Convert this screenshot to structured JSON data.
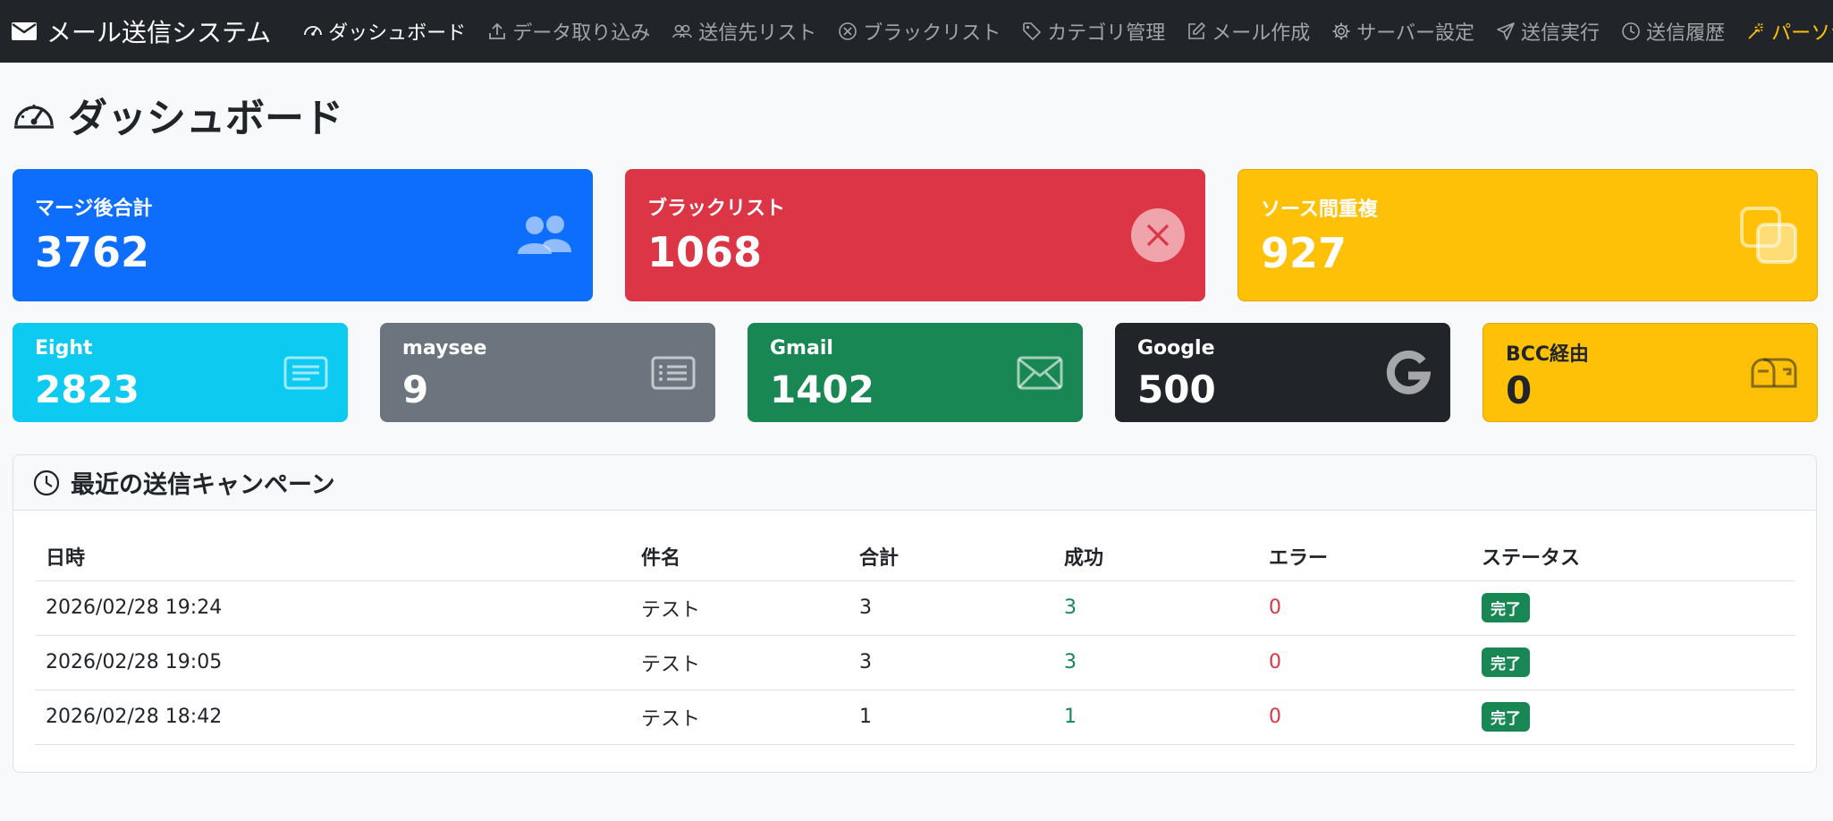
{
  "brand": {
    "title": "メール送信システム",
    "icon": "envelope-icon"
  },
  "nav": [
    {
      "label": "ダッシュボード",
      "icon": "speedometer-icon",
      "state": "active"
    },
    {
      "label": "データ取り込み",
      "icon": "upload-icon",
      "state": "normal"
    },
    {
      "label": "送信先リスト",
      "icon": "people-icon",
      "state": "normal"
    },
    {
      "label": "ブラックリスト",
      "icon": "x-circle-icon",
      "state": "normal"
    },
    {
      "label": "カテゴリ管理",
      "icon": "tag-icon",
      "state": "normal"
    },
    {
      "label": "メール作成",
      "icon": "pencil-square-icon",
      "state": "normal"
    },
    {
      "label": "サーバー設定",
      "icon": "gear-icon",
      "state": "normal"
    },
    {
      "label": "送信実行",
      "icon": "send-icon",
      "state": "normal"
    },
    {
      "label": "送信履歴",
      "icon": "clock-icon",
      "state": "normal"
    },
    {
      "label": "パーソナライズ",
      "icon": "magic-icon",
      "state": "highlight"
    }
  ],
  "page": {
    "title": "ダッシュボード",
    "icon": "speedometer-icon"
  },
  "stats_top": [
    {
      "label": "マージ後合計",
      "value": "3762",
      "icon": "people-icon",
      "color": "#0d6efd"
    },
    {
      "label": "ブラックリスト",
      "value": "1068",
      "icon": "x-circle-icon",
      "color": "#dc3545"
    },
    {
      "label": "ソース間重複",
      "value": "927",
      "icon": "copy-icon",
      "color": "#ffc107"
    }
  ],
  "stats_sources": [
    {
      "label": "Eight",
      "value": "2823",
      "icon": "card-text-icon",
      "color": "#0dcaf0"
    },
    {
      "label": "maysee",
      "value": "9",
      "icon": "card-list-icon",
      "color": "#6c757d"
    },
    {
      "label": "Gmail",
      "value": "1402",
      "icon": "envelope-icon",
      "color": "#198754"
    },
    {
      "label": "Google",
      "value": "500",
      "icon": "google-icon",
      "color": "#212529"
    },
    {
      "label": "BCC経由",
      "value": "0",
      "icon": "mailbox-icon",
      "color": "#ffc107"
    }
  ],
  "campaigns": {
    "title": "最近の送信キャンペーン",
    "icon": "clock-icon",
    "columns": [
      "日時",
      "件名",
      "合計",
      "成功",
      "エラー",
      "ステータス"
    ],
    "rows": [
      {
        "date": "2026/02/28 19:24",
        "subject": "テスト",
        "total": "3",
        "success": "3",
        "error": "0",
        "status": "完了"
      },
      {
        "date": "2026/02/28 19:05",
        "subject": "テスト",
        "total": "3",
        "success": "3",
        "error": "0",
        "status": "完了"
      },
      {
        "date": "2026/02/28 18:42",
        "subject": "テスト",
        "total": "1",
        "success": "1",
        "error": "0",
        "status": "完了"
      }
    ]
  },
  "colors": {
    "navbar": "#212529",
    "background": "#f8f9fa",
    "success": "#198754",
    "danger": "#dc3545",
    "warning": "#ffc107"
  }
}
